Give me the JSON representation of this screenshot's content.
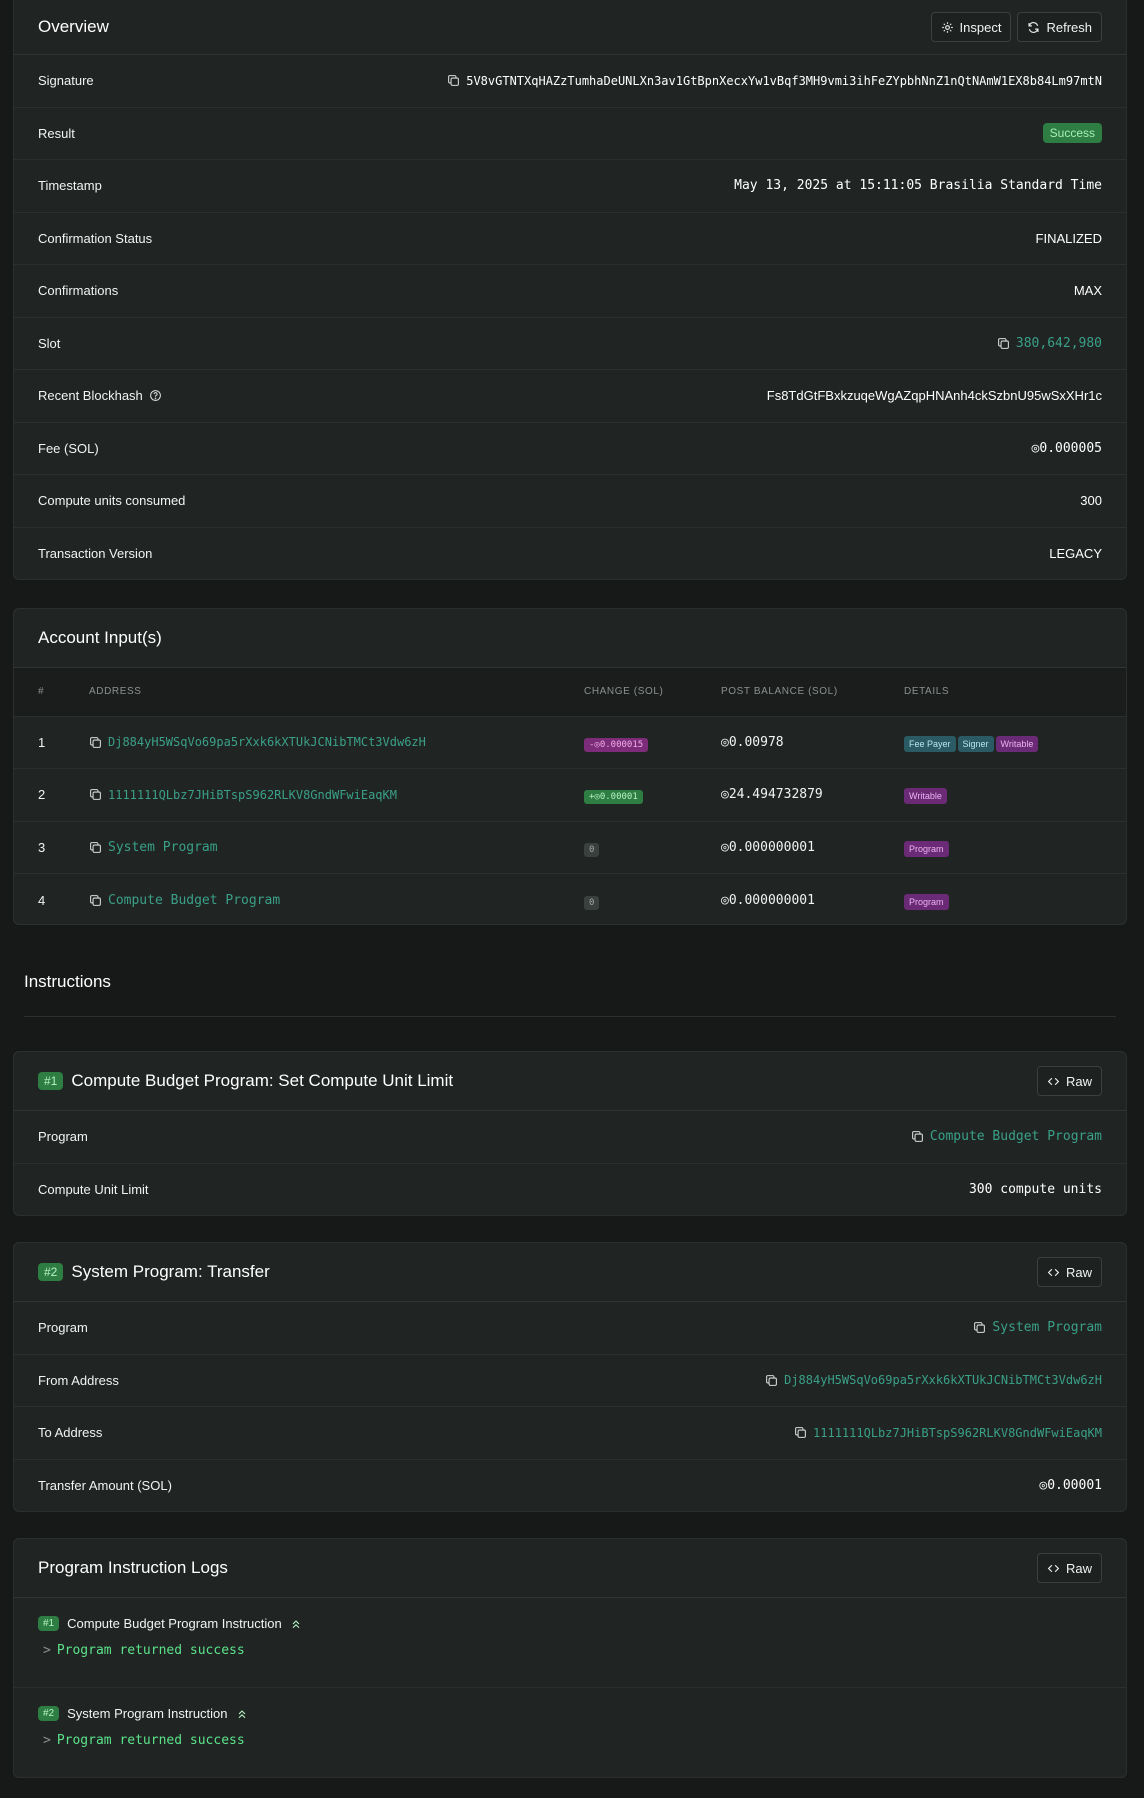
{
  "overview": {
    "title": "Overview",
    "inspect_label": "Inspect",
    "refresh_label": "Refresh",
    "rows": {
      "signature": {
        "label": "Signature",
        "value": "5V8vGTNTXqHAZzTumhaDeUNLXn3av1GtBpnXecxYw1vBqf3MH9vmi3ihFeZYpbhNnZ1nQtNAmW1EX8b84Lm97mtN"
      },
      "result": {
        "label": "Result",
        "value": "Success"
      },
      "timestamp": {
        "label": "Timestamp",
        "value": "May 13, 2025 at 15:11:05 Brasilia Standard Time"
      },
      "confirmation_status": {
        "label": "Confirmation Status",
        "value": "FINALIZED"
      },
      "confirmations": {
        "label": "Confirmations",
        "value": "MAX"
      },
      "slot": {
        "label": "Slot",
        "value": "380,642,980"
      },
      "recent_blockhash": {
        "label": "Recent Blockhash",
        "value": "Fs8TdGtFBxkzuqeWgAZqpHNAnh4ckSzbnU95wSxXHr1c"
      },
      "fee": {
        "label": "Fee (SOL)",
        "value": "◎0.000005"
      },
      "compute_units": {
        "label": "Compute units consumed",
        "value": "300"
      },
      "tx_version": {
        "label": "Transaction Version",
        "value": "LEGACY"
      }
    }
  },
  "accounts": {
    "title": "Account Input(s)",
    "columns": [
      "#",
      "ADDRESS",
      "CHANGE (SOL)",
      "POST BALANCE (SOL)",
      "DETAILS"
    ],
    "rows": [
      {
        "num": "1",
        "address": "Dj884yH5WSqVo69pa5rXxk6kXTUkJCNibTMCt3Vdw6zH",
        "change": "-◎0.000015",
        "balance": "◎0.00978",
        "tags": [
          "Fee Payer",
          "Signer",
          "Writable"
        ]
      },
      {
        "num": "2",
        "address": "1111111QLbz7JHiBTspS962RLKV8GndWFwiEaqKM",
        "change": "+◎0.00001",
        "balance": "◎24.494732879",
        "tags": [
          "Writable"
        ]
      },
      {
        "num": "3",
        "address": "System Program",
        "change": "0",
        "balance": "◎0.000000001",
        "tags": [
          "Program"
        ]
      },
      {
        "num": "4",
        "address": "Compute Budget Program",
        "change": "0",
        "balance": "◎0.000000001",
        "tags": [
          "Program"
        ]
      }
    ]
  },
  "instructions": {
    "title": "Instructions",
    "raw_label": "Raw",
    "items": [
      {
        "num": "#1",
        "title": "Compute Budget Program: Set Compute Unit Limit",
        "rows": [
          {
            "label": "Program",
            "value": "Compute Budget Program"
          },
          {
            "label": "Compute Unit Limit",
            "value": "300 compute units"
          }
        ]
      },
      {
        "num": "#2",
        "title": "System Program: Transfer",
        "rows": [
          {
            "label": "Program",
            "value": "System Program"
          },
          {
            "label": "From Address",
            "value": "Dj884yH5WSqVo69pa5rXxk6kXTUkJCNibTMCt3Vdw6zH"
          },
          {
            "label": "To Address",
            "value": "1111111QLbz7JHiBTspS962RLKV8GndWFwiEaqKM"
          },
          {
            "label": "Transfer Amount (SOL)",
            "value": "◎0.00001"
          }
        ]
      }
    ]
  },
  "logs": {
    "title": "Program Instruction Logs",
    "raw_label": "Raw",
    "items": [
      {
        "num": "#1",
        "title": "Compute Budget Program Instruction",
        "prompt": ">",
        "message": "Program returned success"
      },
      {
        "num": "#2",
        "title": "System Program Instruction",
        "prompt": ">",
        "message": "Program returned success"
      }
    ]
  },
  "colors": {
    "background": "#161918",
    "card": "#202423",
    "link": "#3aa087",
    "success": "#2e7d43",
    "log_text": "#5be38a",
    "negative_change": "#7c2c78"
  },
  "icons": [
    "gear-icon",
    "refresh-icon",
    "copy-icon",
    "help-icon",
    "code-icon",
    "chevrons-up-icon"
  ]
}
